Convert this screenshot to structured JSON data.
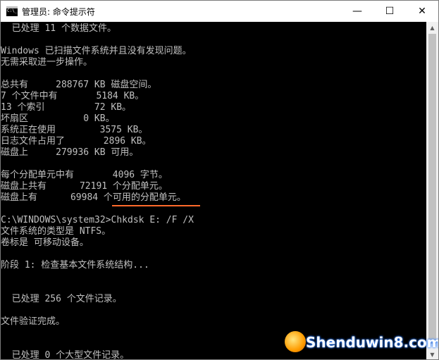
{
  "window": {
    "title": "管理员: 命令提示符",
    "minimize_glyph": "—",
    "maximize_glyph": "☐",
    "close_glyph": "✕"
  },
  "console": {
    "lines": [
      "  已处理 11 个数据文件。",
      "",
      "Windows 已扫描文件系统并且没有发现问题。",
      "无需采取进一步操作。",
      "",
      "总共有     288767 KB 磁盘空间。",
      "7 个文件中有       5184 KB。",
      "13 个索引         72 KB。",
      "坏扇区          0 KB。",
      "系统正在使用        3575 KB。",
      "日志文件占用了       2896 KB。",
      "磁盘上     279936 KB 可用。",
      "",
      "每个分配单元中有       4096 字节。",
      "磁盘上共有      72191 个分配单元。",
      "磁盘上有      69984 个可用的分配单元。",
      "",
      "C:\\WINDOWS\\system32>Chkdsk E: /F /X",
      "文件系统的类型是 NTFS。",
      "卷标是 可移动设备。",
      "",
      "阶段 1: 检查基本文件系统结构...",
      "",
      "",
      "  已处理 256 个文件记录。",
      "",
      "文件验证完成。",
      "",
      "",
      "  已处理 0 个大型文件记录。"
    ]
  },
  "scrollbar": {
    "up_glyph": "▲",
    "down_glyph": "▼"
  },
  "watermark": {
    "text": "Shenduwin8.com"
  },
  "colors": {
    "console_background": "#000000",
    "console_text": "#c0c0c0",
    "command_underline": "#ff6a2b",
    "titlebar_background": "#ffffff"
  }
}
